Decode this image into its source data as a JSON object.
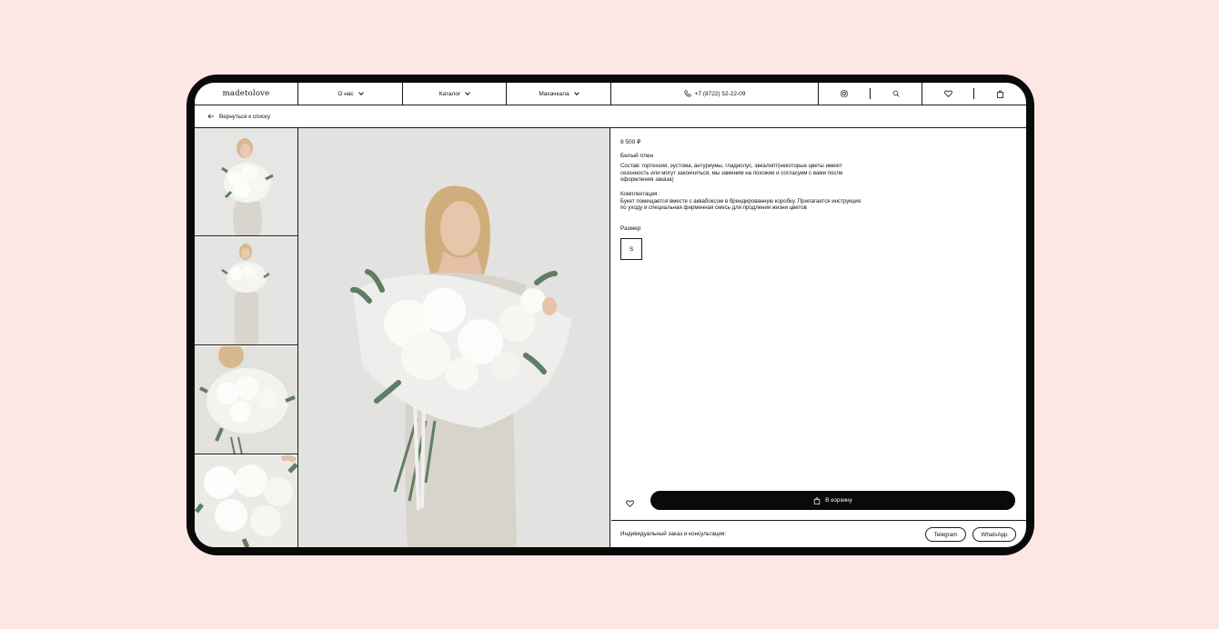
{
  "header": {
    "logo": "madetolove",
    "about": "О нас",
    "catalog": "Каталог",
    "city": "Махачкала",
    "phone": "+7 (8722) 52-22-09"
  },
  "back_label": "Вернуться к списку",
  "product": {
    "price": "8 500 ₽",
    "name": "Белый плен",
    "composition": "Состав: гортензия, эустома, антуриумы, гладиолус, эвкалипт(некоторые цветы имеют сезонность или могут закончиться, мы заменим на похожие и согласуем с вами после оформления заказа)",
    "kit_title": "Комплектация :",
    "kit_text": "Букет помещается вместе с аквабоксом в брендированную коробку. Прилагается инструкция по уходу и специальная фирменная смесь для продления жизни цветов",
    "size_label": "Размер",
    "size_value": "S",
    "cart_label": "В корзину"
  },
  "consult": {
    "label": "Индивидуальный заказ и консультация:",
    "telegram": "Telegram",
    "whatsapp": "WhatsApp"
  },
  "colors": {
    "background": "#fde7e5",
    "device": "#0a0a0a",
    "accent": "#0a0a0a"
  },
  "icons": [
    "chevron-down-icon",
    "phone-icon",
    "instagram-icon",
    "search-icon",
    "heart-icon",
    "bag-icon",
    "arrow-left-icon"
  ]
}
